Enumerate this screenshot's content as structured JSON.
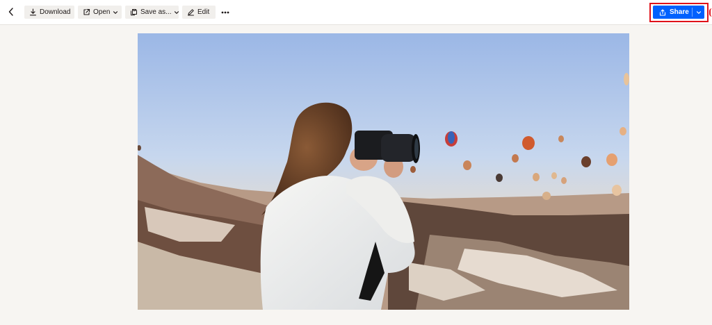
{
  "toolbar": {
    "download_label": "Download",
    "open_label": "Open",
    "save_as_label": "Save as...",
    "edit_label": "Edit",
    "share_label": "Share"
  },
  "icons": {
    "back": "chevron-left-icon",
    "download": "download-icon",
    "open": "open-external-icon",
    "save_as": "save-as-icon",
    "edit": "pencil-icon",
    "more": "more-horizontal-icon",
    "share": "share-icon",
    "dropdown": "chevron-down-icon"
  },
  "colors": {
    "share_button": "#0061fe",
    "highlight": "#e0121a",
    "background": "#f7f5f2"
  }
}
